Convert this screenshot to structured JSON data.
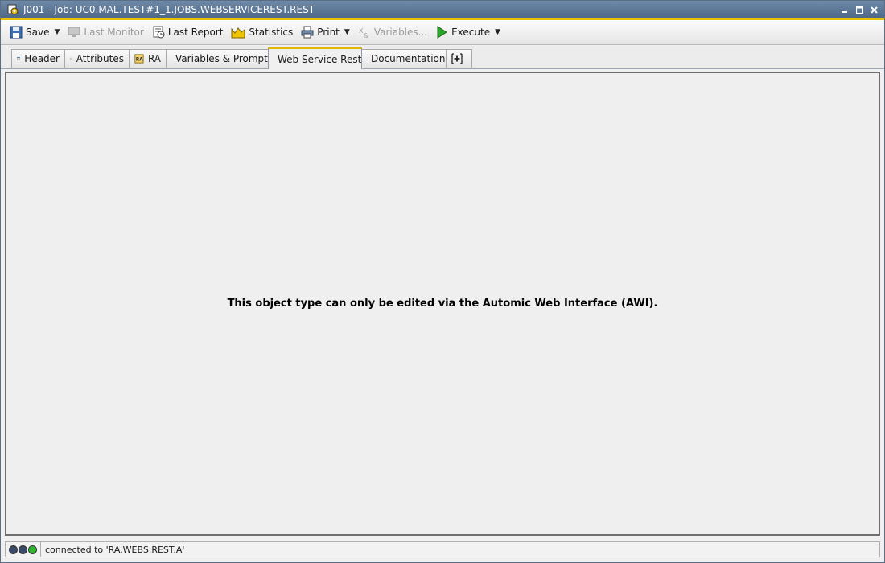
{
  "window": {
    "title": "J001 - Job: UC0.MAL.TEST#1_1.JOBS.WEBSERVICEREST.REST"
  },
  "toolbar": {
    "save": "Save",
    "last_monitor": "Last Monitor",
    "last_report": "Last Report",
    "statistics": "Statistics",
    "print": "Print",
    "variables": "Variables...",
    "execute": "Execute"
  },
  "tabs": [
    {
      "label": "Header",
      "icon": "header-icon",
      "active": false
    },
    {
      "label": "Attributes",
      "icon": "attributes-icon",
      "active": false
    },
    {
      "label": "RA",
      "icon": "ra-icon",
      "active": false
    },
    {
      "label": "Variables & Prompts",
      "icon": "variables-prompts-icon",
      "active": false
    },
    {
      "label": "Web Service Rest",
      "icon": "web-service-rest-icon",
      "active": true
    },
    {
      "label": "Documentation",
      "icon": "documentation-icon",
      "active": false
    }
  ],
  "content": {
    "message": "This object type can only be edited via the Automic Web Interface (AWI)."
  },
  "status": {
    "text": "connected to 'RA.WEBS.REST.A'",
    "light_colors": [
      "#3a4a6a",
      "#3a4a6a",
      "#2fb52f"
    ]
  },
  "colors": {
    "accent": "#e0b800",
    "titlebar": "#55708f"
  }
}
